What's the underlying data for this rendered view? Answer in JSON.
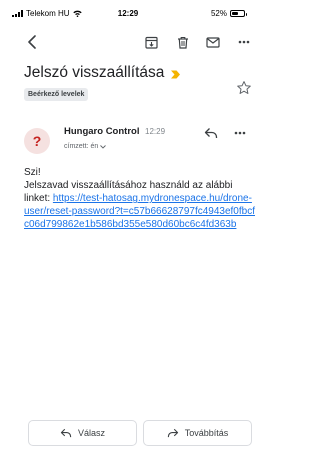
{
  "status_bar": {
    "carrier": "Telekom HU",
    "time": "12:29",
    "battery": "52%",
    "battery_level": 0.52
  },
  "toolbar": {
    "icons": [
      "back-arrow-icon",
      "archive-icon",
      "trash-icon",
      "mail-icon",
      "more-icon"
    ]
  },
  "email": {
    "subject": "Jelszó visszaállítása",
    "label": "Beérkező levelek",
    "sender_initial": "?",
    "sender_name": "Hungaro Control",
    "sent_time": "12:29",
    "recipient": "címzett: én",
    "body_greeting": "Szi!",
    "body_text": "Jelszavad visszaállításához használd az alábbi linket: ",
    "reset_link": "https://test-hatosag.mydronespace.hu/drone-user/reset-password?t=c57b66628797fc4943ef0fbcfc06d799862e1b586bd355e580d60bc6c4fd363b"
  },
  "actions": {
    "reply_label": "Válasz",
    "forward_label": "Továbbítás"
  },
  "colors": {
    "important_marker": "#f4b400",
    "link": "#1a73e8",
    "avatar_text": "#c5221f",
    "avatar_bg": "#f5e1e0"
  }
}
